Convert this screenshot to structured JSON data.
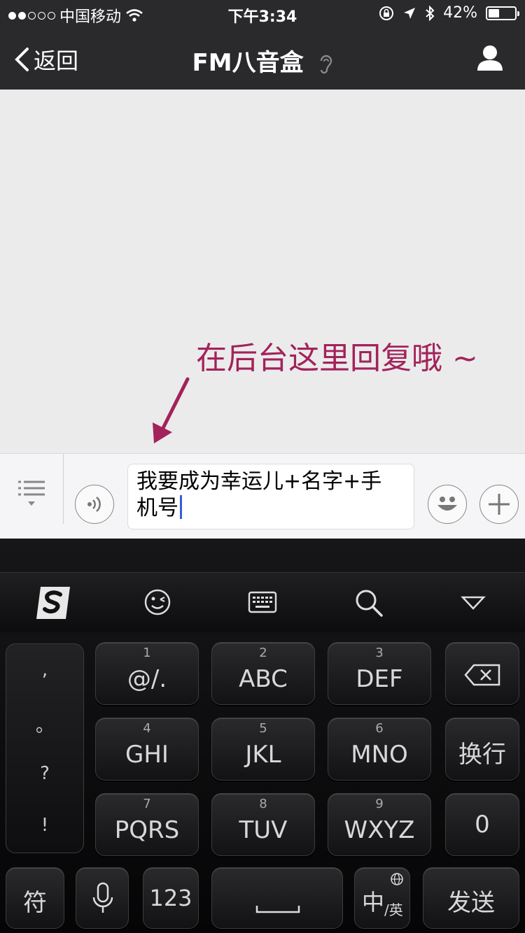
{
  "status": {
    "carrier": "中国移动",
    "time": "下午3:34",
    "battery": "42%",
    "battery_level": 0.42,
    "signal_bars_filled": 2,
    "signal_bars_total": 5
  },
  "nav": {
    "back_label": "返回",
    "title": "FM八音盒"
  },
  "chat": {
    "annotation": "在后台这里回复哦 ~"
  },
  "input": {
    "text_line1": "我要成为幸运儿+名字+手",
    "text_line2": "机号"
  },
  "toolbar": {
    "icons": [
      "sogou-logo-icon",
      "emoji-icon",
      "keyboard-icon",
      "search-icon",
      "collapse-icon"
    ]
  },
  "keyboard": {
    "punct": [
      ",",
      "。",
      "?",
      "!"
    ],
    "keys": [
      {
        "num": "1",
        "label": "@/."
      },
      {
        "num": "2",
        "label": "ABC"
      },
      {
        "num": "3",
        "label": "DEF"
      },
      {
        "num": "4",
        "label": "GHI"
      },
      {
        "num": "5",
        "label": "JKL"
      },
      {
        "num": "6",
        "label": "MNO"
      },
      {
        "num": "7",
        "label": "PQRS"
      },
      {
        "num": "8",
        "label": "TUV"
      },
      {
        "num": "9",
        "label": "WXYZ"
      }
    ],
    "newline": "换行",
    "zero": "0",
    "symbol": "符",
    "num_switch": "123",
    "lang_main": "中",
    "lang_sub": "/英",
    "send": "发送"
  }
}
